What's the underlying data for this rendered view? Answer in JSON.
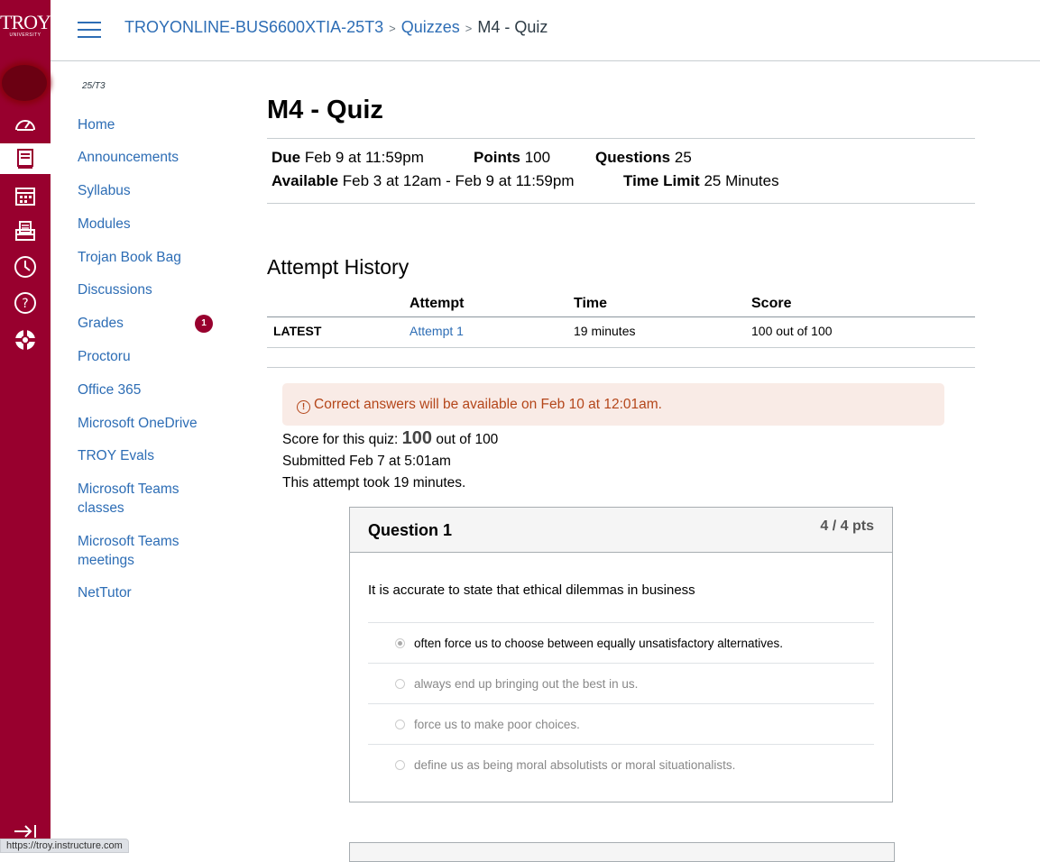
{
  "brand": {
    "logo_main": "TROY",
    "logo_sub": "UNIVERSITY",
    "color": "#98002e"
  },
  "global_nav": {
    "icons": [
      "dashboard-icon",
      "courses-icon",
      "calendar-icon",
      "inbox-icon",
      "history-icon",
      "help-icon",
      "support-icon"
    ],
    "active": "courses-icon"
  },
  "status_url": "https://troy.instructure.com",
  "breadcrumb": {
    "course": "TROYONLINE-BUS6600XTIA-25T3",
    "section": "Quizzes",
    "current": "M4 - Quiz"
  },
  "course_nav": {
    "term": "25/T3",
    "items": [
      {
        "label": "Home"
      },
      {
        "label": "Announcements"
      },
      {
        "label": "Syllabus"
      },
      {
        "label": "Modules"
      },
      {
        "label": "Trojan Book Bag"
      },
      {
        "label": "Discussions"
      },
      {
        "label": "Grades",
        "badge": "1"
      },
      {
        "label": "Proctoru"
      },
      {
        "label": "Office 365"
      },
      {
        "label": "Microsoft OneDrive"
      },
      {
        "label": "TROY Evals"
      },
      {
        "label": "Microsoft Teams classes"
      },
      {
        "label": "Microsoft Teams meetings"
      },
      {
        "label": "NetTutor"
      }
    ]
  },
  "quiz": {
    "title": "M4 - Quiz",
    "due_label": "Due",
    "due": "Feb 9 at 11:59pm",
    "points_label": "Points",
    "points": "100",
    "questions_label": "Questions",
    "questions": "25",
    "available_label": "Available",
    "available": "Feb 3 at 12am - Feb 9 at 11:59pm",
    "time_limit_label": "Time Limit",
    "time_limit": "25 Minutes"
  },
  "attempt_history": {
    "heading": "Attempt History",
    "columns": [
      "",
      "Attempt",
      "Time",
      "Score"
    ],
    "rows": [
      {
        "tag": "LATEST",
        "attempt": "Attempt 1",
        "time": "19 minutes",
        "score": "100 out of 100"
      }
    ]
  },
  "alert": {
    "icon": "!",
    "text": "Correct answers will be available on Feb 10 at 12:01am."
  },
  "summary": {
    "score_prefix": "Score for this quiz:",
    "score": "100",
    "score_suffix": "out of 100",
    "submitted": "Submitted Feb 7 at 5:01am",
    "took": "This attempt took 19 minutes."
  },
  "question1": {
    "title": "Question 1",
    "points": "4 / 4 pts",
    "text": "It is accurate to state that ethical dilemmas in business",
    "answers": [
      {
        "text": "often force us to choose between equally unsatisfactory alternatives.",
        "selected": true
      },
      {
        "text": "always end up bringing out the best in us.",
        "selected": false
      },
      {
        "text": "force us to make poor choices.",
        "selected": false
      },
      {
        "text": "define us as being moral absolutists or moral situationalists.",
        "selected": false
      }
    ]
  }
}
